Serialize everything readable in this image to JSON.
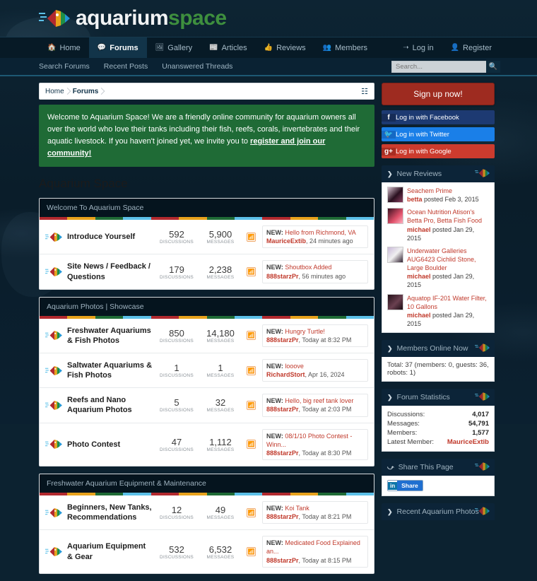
{
  "site": {
    "logo_primary": "aquarium",
    "logo_secondary": "space",
    "logo_icon": "fish-logo-icon"
  },
  "nav": {
    "items": [
      {
        "label": "Home",
        "icon": "home-icon",
        "active": false
      },
      {
        "label": "Forums",
        "icon": "comment-icon",
        "active": true
      },
      {
        "label": "Gallery",
        "icon": "image-icon",
        "active": false
      },
      {
        "label": "Articles",
        "icon": "newspaper-icon",
        "active": false
      },
      {
        "label": "Reviews",
        "icon": "thumbs-up-icon",
        "active": false
      },
      {
        "label": "Members",
        "icon": "users-icon",
        "active": false
      }
    ],
    "right": [
      {
        "label": "Log in",
        "icon": "sign-in-icon"
      },
      {
        "label": "Register",
        "icon": "user-plus-icon"
      }
    ]
  },
  "subnav": {
    "links": [
      "Search Forums",
      "Recent Posts",
      "Unanswered Threads"
    ],
    "search_placeholder": "Search...",
    "search_value": "",
    "search_icon": "search-icon"
  },
  "breadcrumb": {
    "items": [
      {
        "label": "Home",
        "bold": false
      },
      {
        "label": "Forums",
        "bold": true
      }
    ],
    "sitemap_icon": "sitemap-icon"
  },
  "welcome": {
    "text": "Welcome to Aquarium Space! We are a friendly online community for aquarium owners all over the world who love their tanks including their fish, reefs, corals, invertebrates and their aquatic livestock. If you haven't joined yet, we invite you to ",
    "link": "register and join our community!"
  },
  "page_title": "Aquarium Space",
  "stat_labels": {
    "discussions": "DISCUSSIONS",
    "messages": "MESSAGES"
  },
  "new_prefix": "NEW:",
  "sections": [
    {
      "title": "Welcome To Aquarium Space",
      "forums": [
        {
          "name": "Introduce Yourself",
          "discussions": "592",
          "messages": "5,900",
          "last_title": "Hello from Richmond, VA",
          "last_user": "MauriceExtib",
          "last_time": ", 24 minutes ago"
        },
        {
          "name": "Site News / Feedback / Questions",
          "discussions": "179",
          "messages": "2,238",
          "last_title": "Shoutbox Added",
          "last_user": "888starzPr",
          "last_time": ", 56 minutes ago"
        }
      ]
    },
    {
      "title": "Aquarium Photos | Showcase",
      "forums": [
        {
          "name": "Freshwater Aquariums & Fish Photos",
          "discussions": "850",
          "messages": "14,180",
          "last_title": "Hungry Turtle!",
          "last_user": "888starzPr",
          "last_time": ", Today at 8:32 PM"
        },
        {
          "name": "Saltwater Aquariums & Fish Photos",
          "discussions": "1",
          "messages": "1",
          "last_title": "looove",
          "last_user": "RichardStort",
          "last_time": ", Apr 16, 2024"
        },
        {
          "name": "Reefs and Nano Aquarium Photos",
          "discussions": "5",
          "messages": "32",
          "last_title": "Hello, big reef tank lover",
          "last_user": "888starzPr",
          "last_time": ", Today at 2:03 PM"
        },
        {
          "name": "Photo Contest",
          "discussions": "47",
          "messages": "1,112",
          "last_title": "08/1/10 Photo Contest - Winn...",
          "last_user": "888starzPr",
          "last_time": ", Today at 8:30 PM"
        }
      ]
    },
    {
      "title": "Freshwater Aquarium Equipment & Maintenance",
      "forums": [
        {
          "name": "Beginners, New Tanks, Recommendations",
          "discussions": "12",
          "messages": "49",
          "last_title": "Koi Tank",
          "last_user": "888starzPr",
          "last_time": ", Today at 8:21 PM"
        },
        {
          "name": "Aquarium Equipment & Gear",
          "discussions": "532",
          "messages": "6,532",
          "last_title": "Medicated Food Explained an...",
          "last_user": "888starzPr",
          "last_time": ", Today at 8:15 PM"
        }
      ]
    }
  ],
  "sidebar": {
    "signup_label": "Sign up now!",
    "social": [
      {
        "label": "Log in with Facebook",
        "icon": "facebook-icon",
        "glyph": "f",
        "color": "#1d3a72"
      },
      {
        "label": "Log in with Twitter",
        "icon": "twitter-icon",
        "glyph": "\u0014",
        "color": "#1a7fe8"
      },
      {
        "label": "Log in with Google",
        "icon": "google-plus-icon",
        "glyph": "g+",
        "color": "#cc3b2e"
      }
    ],
    "new_reviews": {
      "title": "New Reviews",
      "items": [
        {
          "title": "Seachem Prime",
          "user": "betta",
          "meta": " posted Feb 3, 2015"
        },
        {
          "title": "Ocean Nutrition Atison's Betta Pro, Betta Fish Food",
          "user": "michael",
          "meta": " posted Jan 29, 2015"
        },
        {
          "title": "Underwater Galleries AUG6423 Cichlid Stone, Large Boulder",
          "user": "michael",
          "meta": " posted Jan 29, 2015"
        },
        {
          "title": "Aquatop IF-201 Water Filter, 10 Gallons",
          "user": "michael",
          "meta": " posted Jan 29, 2015"
        }
      ]
    },
    "members_online": {
      "title": "Members Online Now",
      "text": "Total: 37 (members: 0, guests: 36, robots: 1)"
    },
    "forum_statistics": {
      "title": "Forum Statistics",
      "rows": [
        {
          "key": "Discussions:",
          "value": "4,017",
          "link": false
        },
        {
          "key": "Messages:",
          "value": "54,791",
          "link": false
        },
        {
          "key": "Members:",
          "value": "1,577",
          "link": false
        },
        {
          "key": "Latest Member:",
          "value": "MauriceExtib",
          "link": true
        }
      ]
    },
    "share": {
      "title": "Share This Page",
      "button_mark": "in",
      "button_label": "Share"
    },
    "recent_photos": {
      "title": "Recent Aquarium Photos"
    }
  },
  "colors": {
    "accent_green": "#1f6b36",
    "accent_red": "#c0392b",
    "header_dark": "#05141e",
    "nav_dark": "#071a26",
    "stripe": [
      "#b2292e",
      "#e8a21c",
      "#1f6b36",
      "#5cc0e8"
    ]
  }
}
